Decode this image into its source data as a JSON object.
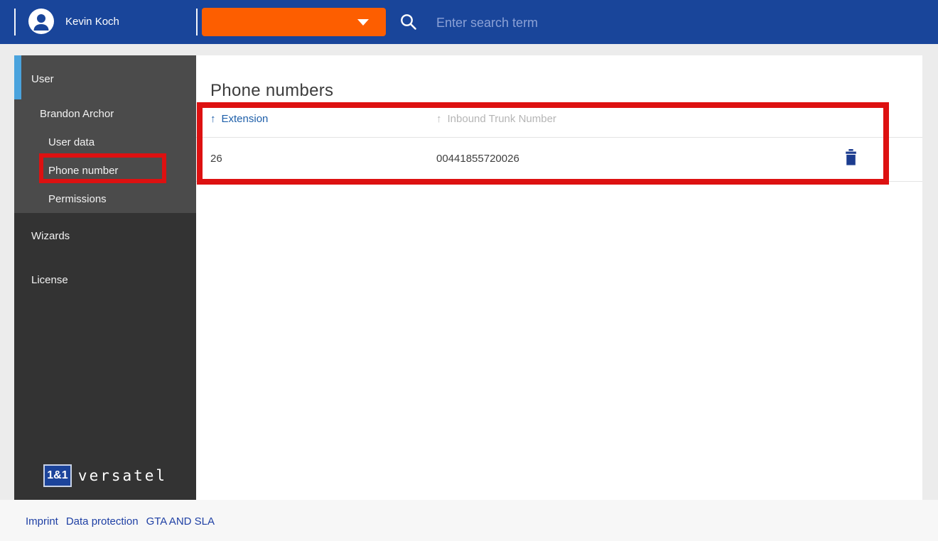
{
  "topbar": {
    "user_name": "Kevin Koch",
    "dropdown_label": "",
    "search_placeholder": "Enter search term"
  },
  "sidebar": {
    "items": {
      "user": "User",
      "brandon_archor": "Brandon Archor",
      "user_data": "User data",
      "phone_number": "Phone number",
      "permissions": "Permissions",
      "wizards": "Wizards",
      "license": "License"
    },
    "logo": {
      "badge": "1&1",
      "brand": "versatel"
    }
  },
  "main": {
    "title": "Phone numbers",
    "table": {
      "sort_icon": "↑",
      "columns": {
        "extension": "Extension",
        "inbound_trunk_number": "Inbound Trunk Number"
      },
      "rows": [
        {
          "extension": "26",
          "inbound_trunk_number": "00441855720026"
        }
      ]
    }
  },
  "footer": {
    "links": {
      "imprint": "Imprint",
      "data_protection": "Data protection",
      "gta_and_sla": "GTA AND SLA"
    }
  },
  "colors": {
    "topbar_blue": "#19459a",
    "brand_orange": "#fd5e00",
    "sidebar_active_accent": "#4aa3dd",
    "sorted_column_blue": "#1e5fa9",
    "trash_icon_blue": "#1c3c8f",
    "annotation_red": "#dd1111",
    "footer_link_blue": "#1e3fa4"
  }
}
